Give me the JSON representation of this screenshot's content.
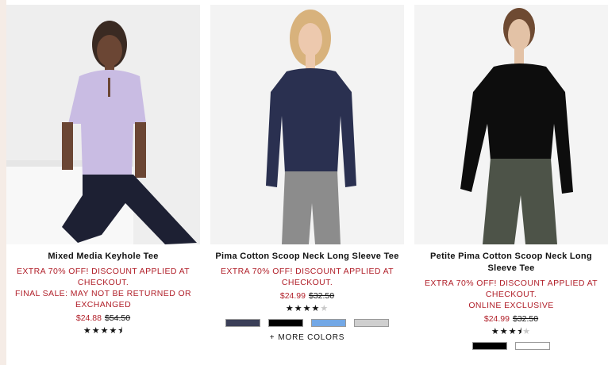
{
  "products": [
    {
      "name": "Mixed Media Keyhole Tee",
      "promo": "EXTRA 70% OFF! DISCOUNT APPLIED AT CHECKOUT.",
      "promo2": "FINAL SALE: MAY NOT BE RETURNED OR EXCHANGED",
      "price": "$24.88",
      "original_price": "$54.50",
      "rating": 4.5,
      "swatches": [],
      "more_colors": ""
    },
    {
      "name": "Pima Cotton Scoop Neck Long Sleeve Tee",
      "promo": "EXTRA 70% OFF! DISCOUNT APPLIED AT CHECKOUT.",
      "promo2": "",
      "price": "$24.99",
      "original_price": "$32.50",
      "rating": 4,
      "swatches": [
        "#3b3f58",
        "#000000",
        "#73a8e6",
        "#cfcfcf"
      ],
      "more_colors": "MORE COLORS"
    },
    {
      "name": "Petite Pima Cotton Scoop Neck Long Sleeve Tee",
      "promo": "EXTRA 70% OFF! DISCOUNT APPLIED AT CHECKOUT.",
      "promo2": "ONLINE EXCLUSIVE",
      "price": "$24.99",
      "original_price": "$32.50",
      "rating": 3.5,
      "swatches": [
        "#000000",
        "#ffffff"
      ],
      "more_colors": ""
    }
  ],
  "colors": {
    "promo_red": "#b1202a",
    "photo_bg": "#f1f1f1"
  }
}
